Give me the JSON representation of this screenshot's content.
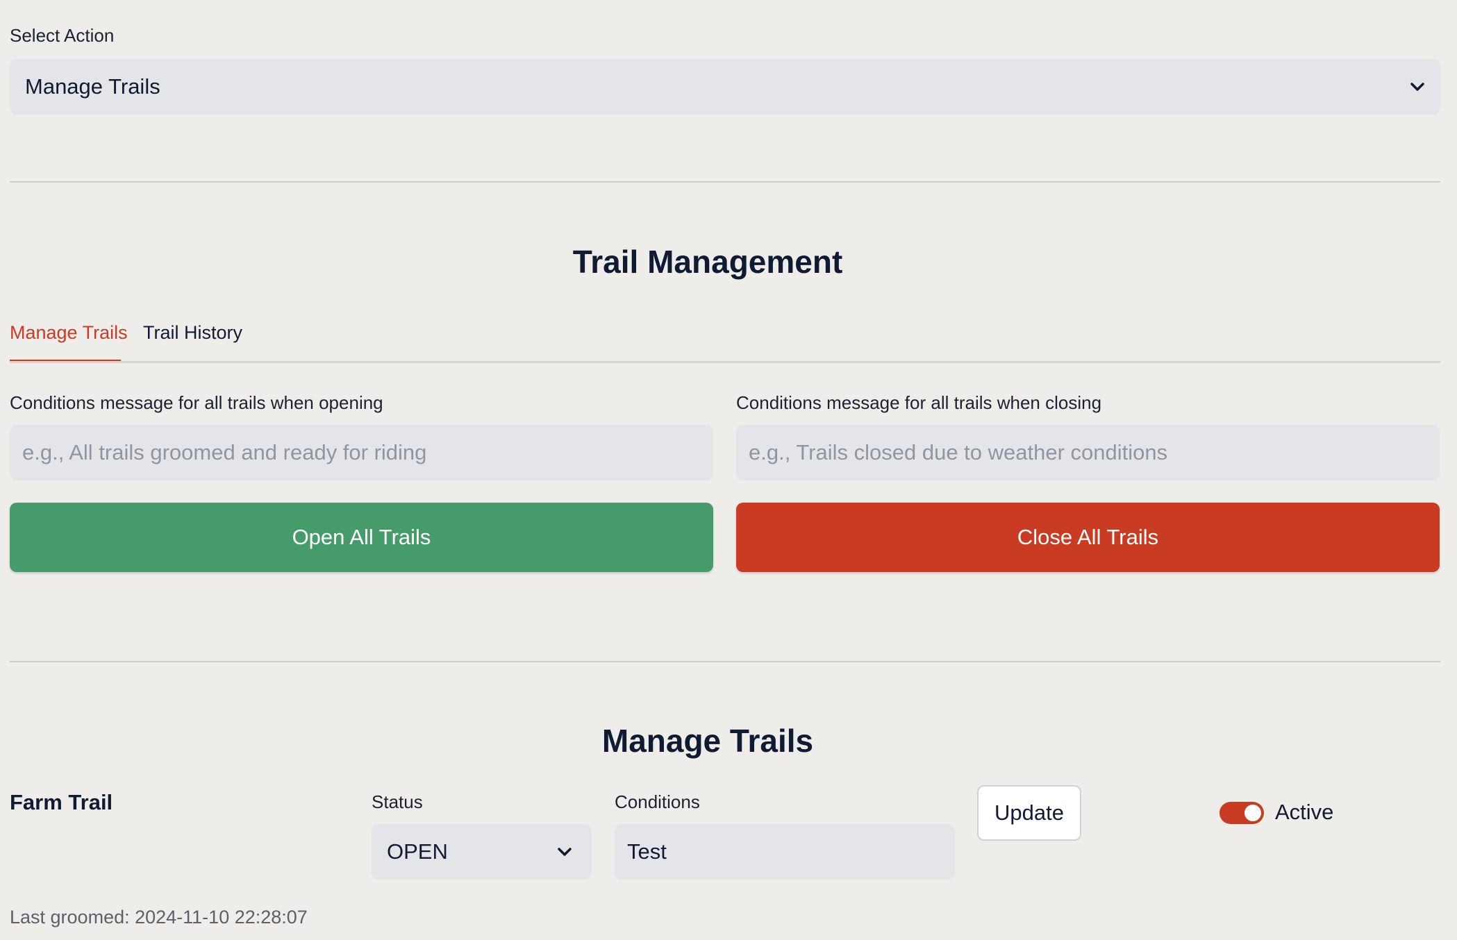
{
  "colors": {
    "background": "#efedea",
    "accent": "#c93b23",
    "open_button": "#469b6a",
    "close_button": "#c93b23",
    "input_bg": "#e4e5e8"
  },
  "action_select": {
    "label": "Select Action",
    "value": "Manage Trails",
    "icon": "chevron-down-icon"
  },
  "trail_management": {
    "title": "Trail Management",
    "tabs": [
      {
        "label": "Manage Trails",
        "active": true
      },
      {
        "label": "Trail History",
        "active": false
      }
    ],
    "opening": {
      "label": "Conditions message for all trails when opening",
      "placeholder": "e.g., All trails groomed and ready for riding",
      "button": "Open All Trails"
    },
    "closing": {
      "label": "Conditions message for all trails when closing",
      "placeholder": "e.g., Trails closed due to weather conditions",
      "button": "Close All Trails"
    }
  },
  "manage_trails": {
    "title": "Manage Trails",
    "trail": {
      "name": "Farm Trail",
      "status_label": "Status",
      "status_value": "OPEN",
      "conditions_label": "Conditions",
      "conditions_value": "Test",
      "update_button": "Update",
      "active_label": "Active",
      "active": true,
      "last_groomed": "Last groomed: 2024-11-10 22:28:07"
    }
  }
}
